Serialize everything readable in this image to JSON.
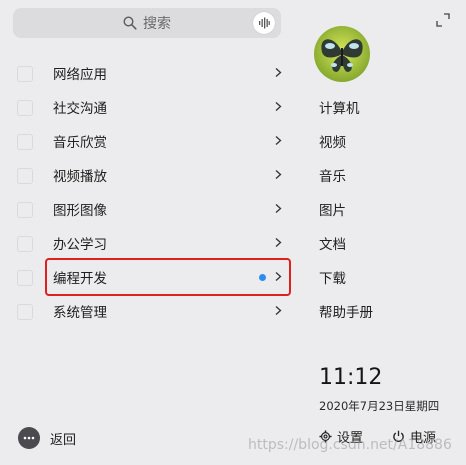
{
  "search": {
    "label": "搜索",
    "icon": "search-icon",
    "voice_icon": "microphone-icon"
  },
  "expand_icon": "expand-icon",
  "categories": [
    {
      "label": "网络应用"
    },
    {
      "label": "社交沟通"
    },
    {
      "label": "音乐欣赏"
    },
    {
      "label": "视频播放"
    },
    {
      "label": "图形图像"
    },
    {
      "label": "办公学习"
    },
    {
      "label": "编程开发",
      "highlighted": true,
      "has_new": true
    },
    {
      "label": "系统管理"
    }
  ],
  "places": [
    "计算机",
    "视频",
    "音乐",
    "图片",
    "文档",
    "下载",
    "帮助手册"
  ],
  "clock": {
    "time": "11:12",
    "date": "2020年7月23日星期四"
  },
  "footer": {
    "back_label": "返回",
    "settings_label": "设置",
    "power_label": "电源"
  },
  "watermark": "https://blog.csdn.net/A18886",
  "colors": {
    "highlight_border": "#e0201c",
    "new_dot": "#2b8cf3",
    "background": "#ececee"
  }
}
